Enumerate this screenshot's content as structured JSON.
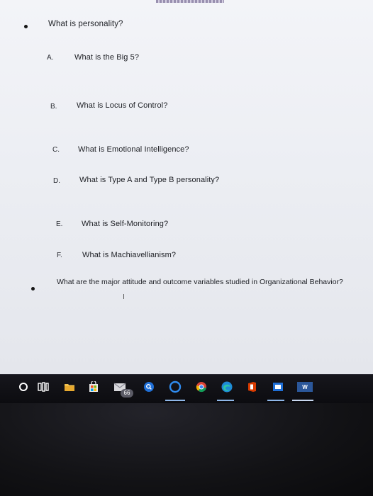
{
  "document": {
    "bullet_1": "What is personality?",
    "items": [
      {
        "letter": "A.",
        "text": "What is the Big 5?"
      },
      {
        "letter": "B.",
        "text": "What is Locus of Control?"
      },
      {
        "letter": "C.",
        "text": "What is Emotional Intelligence?"
      },
      {
        "letter": "D.",
        "text": "What is Type A and Type B personality?"
      },
      {
        "letter": "E.",
        "text": "What is Self-Monitoring?"
      },
      {
        "letter": "F.",
        "text": "What is Machiavellianism?"
      }
    ],
    "bullet_2": "What are the major attitude and outcome variables studied in Organizational Behavior?"
  },
  "taskbar": {
    "mail_badge": "66",
    "icons": [
      "start-icon",
      "task-view-icon",
      "file-explorer-icon",
      "store-icon",
      "mail-icon",
      "search-icon",
      "cortana-icon",
      "chrome-icon",
      "edge-icon",
      "office-icon",
      "photos-icon",
      "word-icon"
    ]
  },
  "colors": {
    "page_bg": "#eceef3",
    "text": "#1d1f24",
    "taskbar": "#0c0c10",
    "accent_blue": "#1f6fd6",
    "word_blue": "#2b579a",
    "office_red": "#d83b01"
  }
}
